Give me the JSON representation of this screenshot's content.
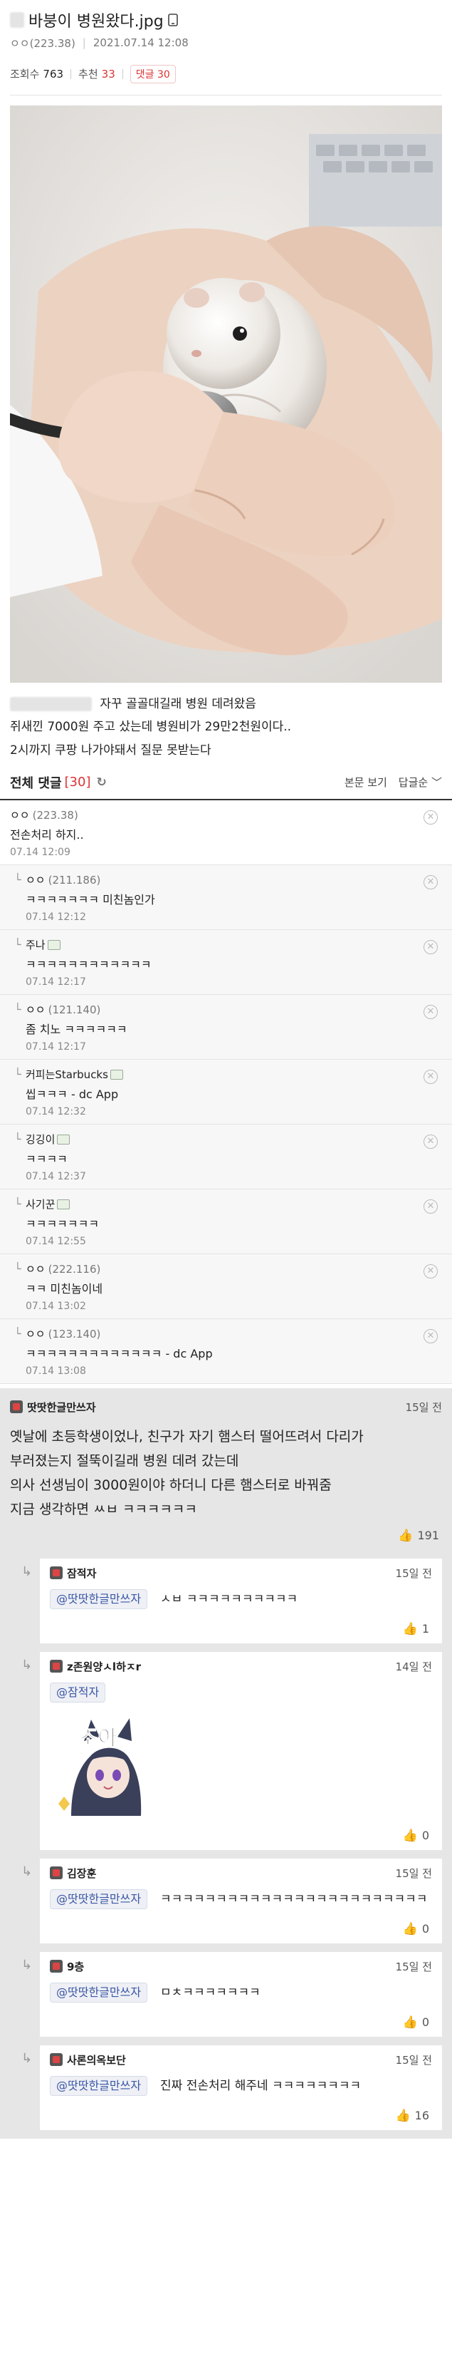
{
  "post": {
    "title": "바붕이 병원왔다.jpg",
    "author_ip": "ㅇㅇ(223.38)",
    "date": "2021.07.14 12:08",
    "views_label": "조회수",
    "views": "763",
    "recommend_label": "추천",
    "recommend": "33",
    "reply_label": "댓글",
    "reply_count": "30",
    "body_lines": [
      "자꾸 골골대길래 병원 데려왔음",
      "쥐새낀 7000원 주고 샀는데 병원비가 29만2천원이다..",
      "2시까지 쿠팡 나가야돼서 질문 못받는다"
    ]
  },
  "comments_header": {
    "title": "전체 댓글",
    "count": "[30]",
    "view_body": "본문 보기",
    "sort": "답글순"
  },
  "comments": [
    {
      "nick": "ㅇㅇ",
      "ip": "(223.38)",
      "text": "전손처리 하지..",
      "time": "07.14 12:09"
    },
    {
      "nick": "ㅇㅇ",
      "ip": "(211.186)",
      "text": "ㅋㅋㅋㅋㅋㅋㅋ 미친놈인가",
      "time": "07.14 12:12"
    },
    {
      "nick": "주나",
      "ip": "",
      "text": "ㅋㅋㅋㅋㅋㅋㅋㅋㅋㅋㅋㅋ",
      "time": "07.14 12:17"
    },
    {
      "nick": "ㅇㅇ",
      "ip": "(121.140)",
      "text": "좀 치노 ㅋㅋㅋㅋㅋㅋ",
      "time": "07.14 12:17"
    },
    {
      "nick": "커피는Starbucks",
      "ip": "",
      "text": "씹ㅋㅋㅋ - dc App",
      "time": "07.14 12:32"
    },
    {
      "nick": "깅깅이",
      "ip": "",
      "text": "ㅋㅋㅋㅋ",
      "time": "07.14 12:37"
    },
    {
      "nick": "사기꾼",
      "ip": "",
      "text": "ㅋㅋㅋㅋㅋㅋㅋ",
      "time": "07.14 12:55"
    },
    {
      "nick": "ㅇㅇ",
      "ip": "(222.116)",
      "text": "ㅋㅋ 미친놈이네",
      "time": "07.14 13:02"
    },
    {
      "nick": "ㅇㅇ",
      "ip": "(123.140)",
      "text": "ㅋㅋㅋㅋㅋㅋㅋㅋㅋㅋㅋㅋㅋ - dc App",
      "time": "07.14 13:08"
    }
  ],
  "best": {
    "nick": "땃땃한글만쓰자",
    "when": "15일 전",
    "lines": [
      "옛날에 초등학생이었나, 친구가 자기 햄스터 떨어뜨려서 다리가",
      "부러졌는지 절뚝이길래 병원 데려 갔는데",
      "의사 선생님이 3000원이야 하더니 다른 햄스터로 바꿔줌",
      "지금 생각하면 ㅆㅂ ㅋㅋㅋㅋㅋㅋ"
    ],
    "likes": "191",
    "replies": [
      {
        "nick": "잠적자",
        "when": "15일 전",
        "mention": "@땃땃한글만쓰자",
        "text": "ㅅㅂ ㅋㅋㅋㅋㅋㅋㅋㅋㅋㅋ",
        "likes": "1"
      },
      {
        "nick": "z존원양ㅅl하ㅈr",
        "when": "14일 전",
        "mention": "@잠적자",
        "text": "",
        "likes": "0",
        "dccon_text": "조아"
      },
      {
        "nick": "김장훈",
        "when": "15일 전",
        "mention": "@땃땃한글만쓰자",
        "text": "ㅋㅋㅋㅋㅋㅋㅋㅋㅋㅋㅋㅋㅋㅋㅋㅋㅋㅋㅋㅋㅋㅋㅋㅋ",
        "likes": "0"
      },
      {
        "nick": "9층",
        "when": "15일 전",
        "mention": "@땃땃한글만쓰자",
        "text": "ㅁㅊㅋㅋㅋㅋㅋㅋㅋ",
        "likes": "0"
      },
      {
        "nick": "사론의옥보단",
        "when": "15일 전",
        "mention": "@땃땃한글만쓰자",
        "text": "진짜 전손처리 해주네 ㅋㅋㅋㅋㅋㅋㅋㅋ",
        "likes": "16"
      }
    ]
  }
}
